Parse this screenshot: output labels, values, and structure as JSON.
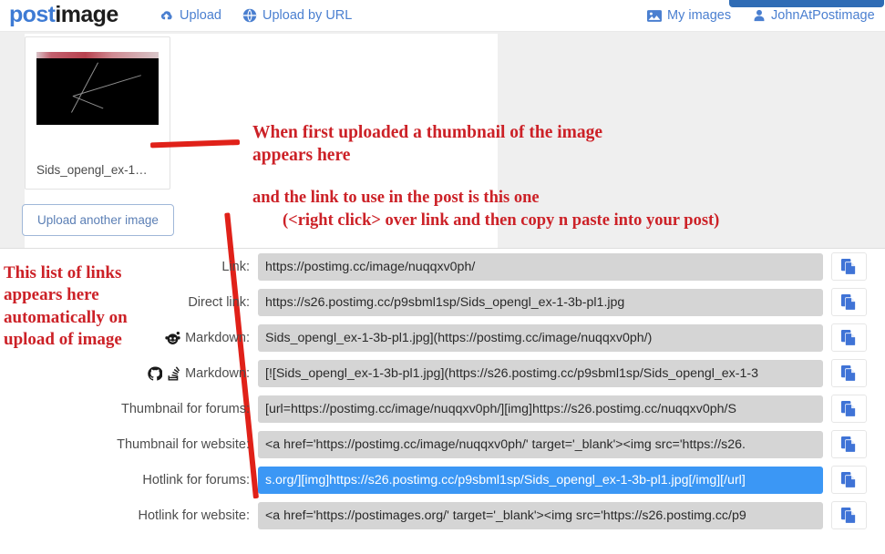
{
  "header": {
    "logo_part1": "post",
    "logo_part2": "image",
    "nav": [
      {
        "label": "Upload",
        "icon": "cloud-upload-icon"
      },
      {
        "label": "Upload by URL",
        "icon": "globe-icon"
      }
    ],
    "my_images": "My images",
    "username": "JohnAtPostimage",
    "accent_color": "#4a7fd0"
  },
  "thumbnail": {
    "filename": "Sids_opengl_ex-1…",
    "upload_another_label": "Upload another image"
  },
  "annotations": {
    "thumb_note_line1": "When first uploaded a thumbnail of the image",
    "thumb_note_line2": "appears here",
    "link_note": "and the link to use in the post is this one",
    "rclick_note": "(<right click> over link and then copy n paste into your post)",
    "list_note_line1": "This list of links",
    "list_note_line2": "appears here",
    "list_note_line3": "automatically on",
    "list_note_line4": "upload of image",
    "color": "#cc2127"
  },
  "links": [
    {
      "label": "Link:",
      "icons": [],
      "value": "https://postimg.cc/image/nuqqxv0ph/",
      "selected": false
    },
    {
      "label": "Direct link:",
      "icons": [],
      "value": "https://s26.postimg.cc/p9sbml1sp/Sids_opengl_ex-1-3b-pl1.jpg",
      "selected": false
    },
    {
      "label": "Markdown:",
      "icons": [
        "reddit-icon"
      ],
      "value": "Sids_opengl_ex-1-3b-pl1.jpg](https://postimg.cc/image/nuqqxv0ph/)",
      "selected": false
    },
    {
      "label": "Markdown:",
      "icons": [
        "github-icon",
        "stackoverflow-icon"
      ],
      "value": "[![Sids_opengl_ex-1-3b-pl1.jpg](https://s26.postimg.cc/p9sbml1sp/Sids_opengl_ex-1-3",
      "selected": false
    },
    {
      "label": "Thumbnail for forums:",
      "icons": [],
      "value": "[url=https://postimg.cc/image/nuqqxv0ph/][img]https://s26.postimg.cc/nuqqxv0ph/S",
      "selected": false
    },
    {
      "label": "Thumbnail for website:",
      "icons": [],
      "value": "<a href='https://postimg.cc/image/nuqqxv0ph/' target='_blank'><img src='https://s26.",
      "selected": false
    },
    {
      "label": "Hotlink for forums:",
      "icons": [],
      "value": "s.org/][img]https://s26.postimg.cc/p9sbml1sp/Sids_opengl_ex-1-3b-pl1.jpg[/img][/url]",
      "selected": true
    },
    {
      "label": "Hotlink for website:",
      "icons": [],
      "value": "<a href='https://postimages.org/' target='_blank'><img src='https://s26.postimg.cc/p9",
      "selected": false
    }
  ],
  "copy_button": {
    "icon": "copy-icon",
    "title": "Copy"
  }
}
